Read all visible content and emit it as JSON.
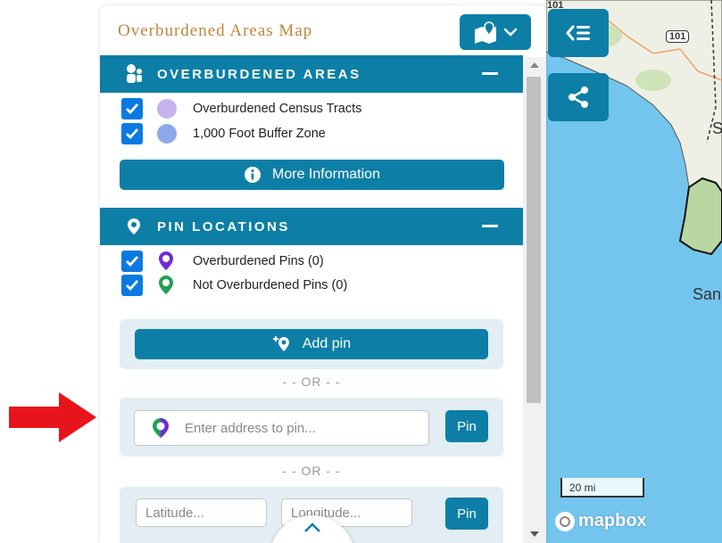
{
  "panel": {
    "title": "Overburdened Areas Map"
  },
  "overburdened": {
    "header": "OVERBURDENED AREAS",
    "layers": [
      {
        "label": "Overburdened Census Tracts",
        "checked": true,
        "color": "#c5b3f0"
      },
      {
        "label": "1,000 Foot Buffer Zone",
        "checked": true,
        "color": "#8ea9e8"
      }
    ],
    "more_info_label": "More Information"
  },
  "pins": {
    "header": "PIN LOCATIONS",
    "layers": [
      {
        "label": "Overburdened Pins (0)",
        "checked": true,
        "color": "#6f2bd6"
      },
      {
        "label": "Not Overburdened Pins (0)",
        "checked": true,
        "color": "#21a055"
      }
    ],
    "add_pin_label": "Add pin",
    "or_text": "- - OR - -",
    "address_placeholder": "Enter address to pin...",
    "pin_button": "Pin",
    "latitude_placeholder": "Latitude...",
    "longitude_placeholder": "Longitude...",
    "pin_button_2": "Pin"
  },
  "map": {
    "route_101_a": "101",
    "route_101_b": "101",
    "label_s": "S",
    "label_san": "San",
    "scale": "20 mi",
    "attribution": "mapbox"
  },
  "colors": {
    "accent": "#0d7fa6",
    "checkbox": "#0a7ae0",
    "title": "#c2843a",
    "water": "#74c5ee"
  }
}
